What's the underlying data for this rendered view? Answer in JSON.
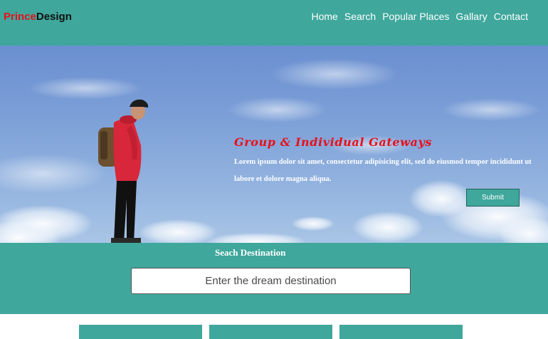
{
  "brand": {
    "part1": "Prince",
    "part2": "Design",
    "color1": "#e8101a",
    "color2": "#111111"
  },
  "nav": {
    "items": [
      {
        "label": "Home"
      },
      {
        "label": "Search"
      },
      {
        "label": "Popular Places"
      },
      {
        "label": "Gallary"
      },
      {
        "label": "Contact"
      }
    ]
  },
  "hero": {
    "title": "Group & Individual Gateways",
    "text": "Lorem ipsum dolor sit amet, consectetur adipisicing elit, sed do eiusmod tempor incididunt ut labore et dolore magna aliqua.",
    "submit_label": "Submit"
  },
  "search": {
    "heading": "Seach Destination",
    "placeholder": "Enter the dream destination",
    "value": ""
  },
  "theme": {
    "accent": "#3fa79c",
    "title_color": "#e8101a"
  }
}
